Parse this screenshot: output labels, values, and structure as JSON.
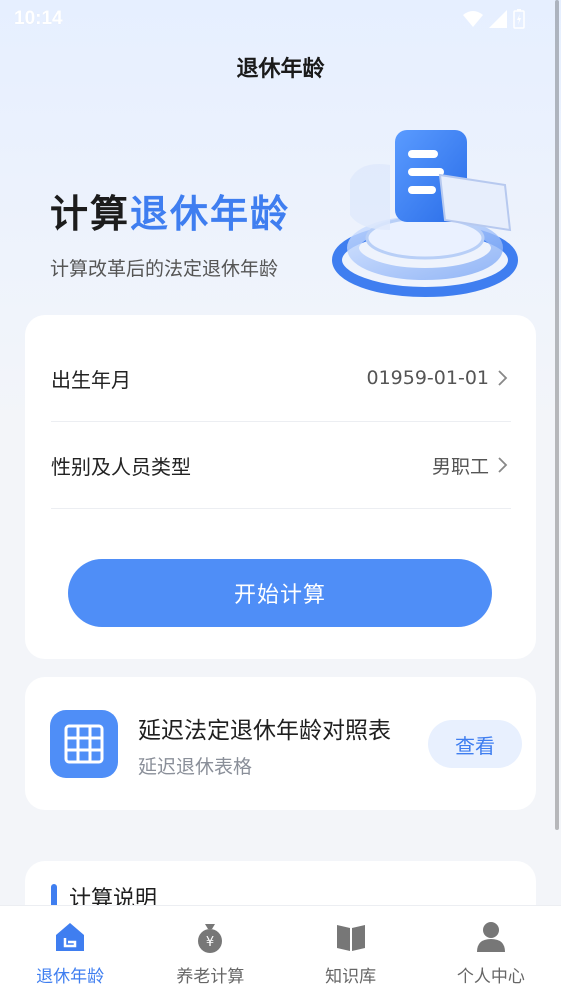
{
  "status": {
    "time": "10:14"
  },
  "header": {
    "title": "退休年龄"
  },
  "hero": {
    "title_plain": "计算",
    "title_accent": "退休年龄",
    "subtitle": "计算改革后的法定退休年龄"
  },
  "form": {
    "birth": {
      "label": "出生年月",
      "value": "01959-01-01"
    },
    "type": {
      "label": "性别及人员类型",
      "value": "男职工"
    },
    "submit_label": "开始计算"
  },
  "table_card": {
    "title": "延迟法定退休年龄对照表",
    "subtitle": "延迟退休表格",
    "button_label": "查看"
  },
  "explain": {
    "title": "计算说明"
  },
  "tabs": [
    {
      "label": "退休年龄",
      "icon": "home-icon",
      "active": true
    },
    {
      "label": "养老计算",
      "icon": "money-bag-icon",
      "active": false
    },
    {
      "label": "知识库",
      "icon": "book-icon",
      "active": false
    },
    {
      "label": "个人中心",
      "icon": "person-icon",
      "active": false
    }
  ],
  "colors": {
    "accent": "#3f7ef0",
    "button": "#4f8ef7",
    "tab_inactive": "#666666"
  }
}
